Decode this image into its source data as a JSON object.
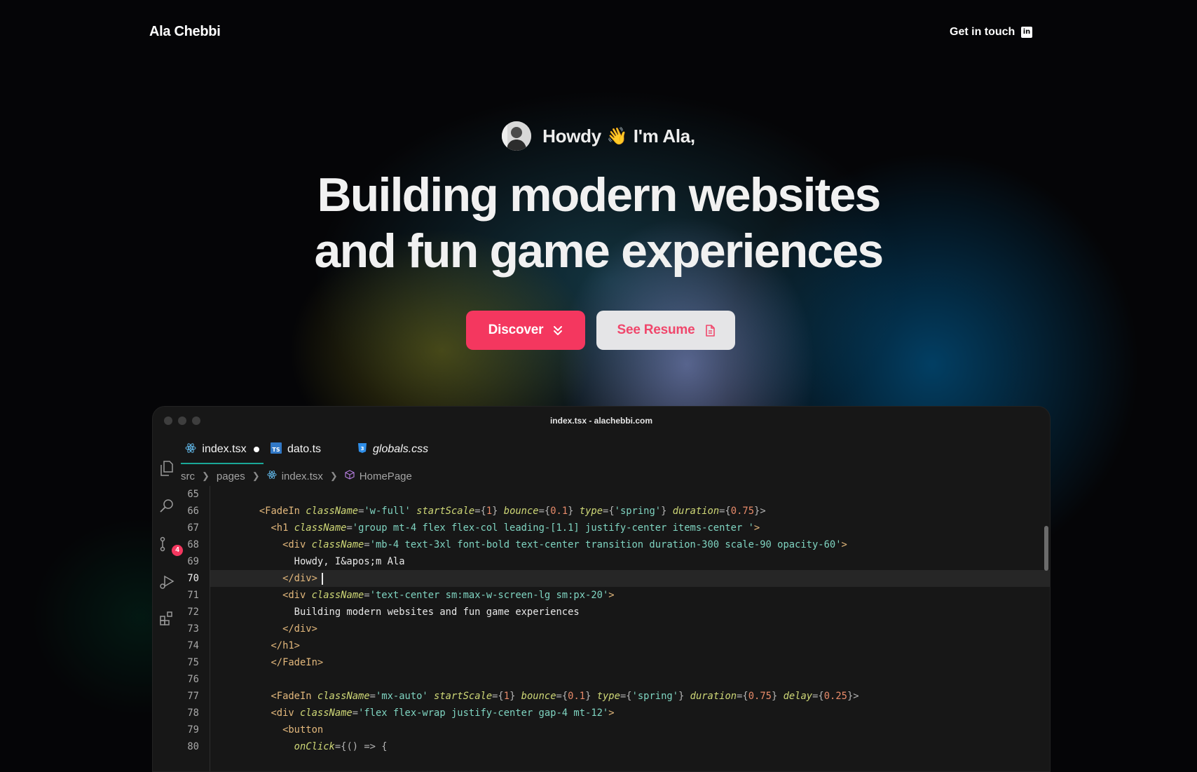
{
  "header": {
    "brand": "Ala Chebbi",
    "contact_label": "Get in touch",
    "linkedin_icon": "linkedin-icon"
  },
  "hero": {
    "greeting_pre": "Howdy",
    "wave": "👋",
    "greeting_post": "I'm Ala,",
    "headline_line1": "Building modern websites",
    "headline_line2": "and fun game experiences",
    "discover_label": "Discover",
    "resume_label": "See Resume"
  },
  "editor": {
    "window_title": "index.tsx - alachebbi.com",
    "tabs": [
      {
        "label": "index.tsx",
        "icon": "react-icon",
        "active": true,
        "modified": true
      },
      {
        "label": "dato.ts",
        "icon": "typescript-icon"
      },
      {
        "label": "globals.css",
        "icon": "css-icon",
        "italic": true
      }
    ],
    "breadcrumb": [
      "src",
      "pages",
      "index.tsx",
      "HomePage"
    ],
    "scm_badge": "4",
    "lines": [
      {
        "n": "65",
        "tokens": []
      },
      {
        "n": "66",
        "tokens": [
          {
            "t": "      <FadeIn ",
            "c": "tag"
          },
          {
            "t": "className",
            "c": "attr"
          },
          {
            "t": "=",
            "c": "punc"
          },
          {
            "t": "'w-full'",
            "c": "str"
          },
          {
            "t": " startScale",
            "c": "attr"
          },
          {
            "t": "={",
            "c": "punc"
          },
          {
            "t": "1",
            "c": "num"
          },
          {
            "t": "}",
            "c": "punc"
          },
          {
            "t": " bounce",
            "c": "attr"
          },
          {
            "t": "={",
            "c": "punc"
          },
          {
            "t": "0.1",
            "c": "num"
          },
          {
            "t": "}",
            "c": "punc"
          },
          {
            "t": " type",
            "c": "attr"
          },
          {
            "t": "={",
            "c": "punc"
          },
          {
            "t": "'spring'",
            "c": "str"
          },
          {
            "t": "}",
            "c": "punc"
          },
          {
            "t": " duration",
            "c": "attr"
          },
          {
            "t": "={",
            "c": "punc"
          },
          {
            "t": "0.75",
            "c": "num"
          },
          {
            "t": "}>",
            "c": "punc"
          }
        ]
      },
      {
        "n": "67",
        "tokens": [
          {
            "t": "        <h1 ",
            "c": "tag"
          },
          {
            "t": "className",
            "c": "attr"
          },
          {
            "t": "=",
            "c": "punc"
          },
          {
            "t": "'group mt-4 flex flex-col leading-[1.1] justify-center items-center '",
            "c": "str"
          },
          {
            "t": ">",
            "c": "tag"
          }
        ]
      },
      {
        "n": "68",
        "tokens": [
          {
            "t": "          <div ",
            "c": "tag"
          },
          {
            "t": "className",
            "c": "attr"
          },
          {
            "t": "=",
            "c": "punc"
          },
          {
            "t": "'mb-4 text-3xl font-bold text-center transition duration-300 scale-90 opacity-60'",
            "c": "str"
          },
          {
            "t": ">",
            "c": "tag"
          }
        ]
      },
      {
        "n": "69",
        "tokens": [
          {
            "t": "            Howdy, I&apos;m Ala",
            "c": "plain"
          }
        ]
      },
      {
        "n": "70",
        "current": true,
        "tokens": [
          {
            "t": "          </div>",
            "c": "tag"
          }
        ]
      },
      {
        "n": "71",
        "tokens": [
          {
            "t": "          <div ",
            "c": "tag"
          },
          {
            "t": "className",
            "c": "attr"
          },
          {
            "t": "=",
            "c": "punc"
          },
          {
            "t": "'text-center sm:max-w-screen-lg sm:px-20'",
            "c": "str"
          },
          {
            "t": ">",
            "c": "tag"
          }
        ]
      },
      {
        "n": "72",
        "tokens": [
          {
            "t": "            Building modern websites and fun game experiences",
            "c": "plain"
          }
        ]
      },
      {
        "n": "73",
        "tokens": [
          {
            "t": "          </div>",
            "c": "tag"
          }
        ]
      },
      {
        "n": "74",
        "tokens": [
          {
            "t": "        </h1>",
            "c": "tag"
          }
        ]
      },
      {
        "n": "75",
        "tokens": [
          {
            "t": "        </FadeIn>",
            "c": "tag"
          }
        ]
      },
      {
        "n": "76",
        "tokens": []
      },
      {
        "n": "77",
        "tokens": [
          {
            "t": "        <FadeIn ",
            "c": "tag"
          },
          {
            "t": "className",
            "c": "attr"
          },
          {
            "t": "=",
            "c": "punc"
          },
          {
            "t": "'mx-auto'",
            "c": "str"
          },
          {
            "t": " startScale",
            "c": "attr"
          },
          {
            "t": "={",
            "c": "punc"
          },
          {
            "t": "1",
            "c": "num"
          },
          {
            "t": "}",
            "c": "punc"
          },
          {
            "t": " bounce",
            "c": "attr"
          },
          {
            "t": "={",
            "c": "punc"
          },
          {
            "t": "0.1",
            "c": "num"
          },
          {
            "t": "}",
            "c": "punc"
          },
          {
            "t": " type",
            "c": "attr"
          },
          {
            "t": "={",
            "c": "punc"
          },
          {
            "t": "'spring'",
            "c": "str"
          },
          {
            "t": "}",
            "c": "punc"
          },
          {
            "t": " duration",
            "c": "attr"
          },
          {
            "t": "={",
            "c": "punc"
          },
          {
            "t": "0.75",
            "c": "num"
          },
          {
            "t": "}",
            "c": "punc"
          },
          {
            "t": " delay",
            "c": "attr"
          },
          {
            "t": "={",
            "c": "punc"
          },
          {
            "t": "0.25",
            "c": "num"
          },
          {
            "t": "}>",
            "c": "punc"
          }
        ]
      },
      {
        "n": "78",
        "tokens": [
          {
            "t": "        <div ",
            "c": "tag"
          },
          {
            "t": "className",
            "c": "attr"
          },
          {
            "t": "=",
            "c": "punc"
          },
          {
            "t": "'flex flex-wrap justify-center gap-4 mt-12'",
            "c": "str"
          },
          {
            "t": ">",
            "c": "tag"
          }
        ]
      },
      {
        "n": "79",
        "tokens": [
          {
            "t": "          <button",
            "c": "tag"
          }
        ]
      },
      {
        "n": "80",
        "tokens": [
          {
            "t": "            onClick",
            "c": "attr"
          },
          {
            "t": "={() => {",
            "c": "punc"
          }
        ]
      }
    ]
  },
  "colors": {
    "accent": "#f4375f",
    "resume_bg": "#e5e5e7",
    "tab_underline": "#1aa898"
  }
}
